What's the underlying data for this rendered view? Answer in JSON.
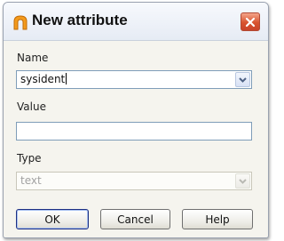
{
  "dialog": {
    "title": "New attribute",
    "close_icon": "close-icon",
    "title_icon": "arch-icon"
  },
  "name": {
    "label": "Name",
    "value": "sysident",
    "dropdown_icon": "chevron-down-icon"
  },
  "value": {
    "label": "Value",
    "value": ""
  },
  "type": {
    "label": "Type",
    "value": "text",
    "enabled": false
  },
  "buttons": {
    "ok": "OK",
    "cancel": "Cancel",
    "help": "Help"
  },
  "colors": {
    "close_button": "#d8532f",
    "title_icon": "#f39a1c",
    "field_border": "#7f9db9"
  }
}
